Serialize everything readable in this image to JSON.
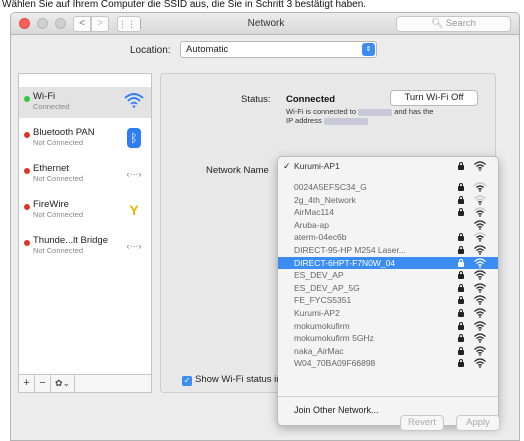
{
  "caption": "Wählen Sie auf Ihrem Computer die SSID aus, die Sie in Schritt 3 bestätigt haben.",
  "window": {
    "title": "Network",
    "search_placeholder": "Search",
    "back_label": "<",
    "forward_label": ">",
    "grid_label": "⋮⋮⋮"
  },
  "location": {
    "label": "Location:",
    "value": "Automatic",
    "arrows": "⇕"
  },
  "services": [
    {
      "name": "Wi-Fi",
      "status": "Connected",
      "status_color": "#2ecb41",
      "icon": "wifi-icon",
      "selected": true
    },
    {
      "name": "Bluetooth PAN",
      "status": "Not Connected",
      "status_color": "#e0332c",
      "icon": "bluetooth-icon",
      "glyph": "ᛒ"
    },
    {
      "name": "Ethernet",
      "status": "Not Connected",
      "status_color": "#e0332c",
      "icon": "ethernet-icon",
      "glyph": "‹···›"
    },
    {
      "name": "FireWire",
      "status": "Not Connected",
      "status_color": "#e0332c",
      "icon": "firewire-icon",
      "glyph": "Y"
    },
    {
      "name": "Thunde...lt Bridge",
      "status": "Not Connected",
      "status_color": "#e0332c",
      "icon": "thunderbolt-bridge-icon",
      "glyph": "‹···›"
    }
  ],
  "sidebar_controls": {
    "add": "+",
    "remove": "−",
    "action": "✿⌄"
  },
  "status": {
    "label": "Status:",
    "value": "Connected",
    "desc_line1_prefix": "Wi-Fi is connected to",
    "desc_line1_suffix": "and has the",
    "desc_line2_prefix": "IP address",
    "turn_off_label": "Turn Wi-Fi Off"
  },
  "network_name_label": "Network Name",
  "network_menu": {
    "check": "✓",
    "items": [
      {
        "name": "Kurumi-AP1",
        "signal": 3,
        "lock": true
      },
      {
        "name": "0024A5EFSC34_G",
        "signal": 2,
        "lock": true
      },
      {
        "name": "2g_4th_Network",
        "signal": 1,
        "lock": true
      },
      {
        "name": "AirMac114",
        "signal": 2,
        "lock": true
      },
      {
        "name": "Aruba-ap",
        "signal": 3,
        "lock": false
      },
      {
        "name": "aterm-04ec6b",
        "signal": 2,
        "lock": true
      },
      {
        "name": "DIRECT-95-HP M254 Laser...",
        "signal": 3,
        "lock": true
      },
      {
        "name": "DIRECT-6HPT-F7N0W_04",
        "signal": 3,
        "lock": true,
        "highlighted": true
      },
      {
        "name": "ES_DEV_AP",
        "signal": 3,
        "lock": true
      },
      {
        "name": "ES_DEV_AP_5G",
        "signal": 3,
        "lock": true
      },
      {
        "name": "FE_FYCS5351",
        "signal": 3,
        "lock": true
      },
      {
        "name": "Kurumi-AP2",
        "signal": 3,
        "lock": true
      },
      {
        "name": "mokumokufirm",
        "signal": 3,
        "lock": true
      },
      {
        "name": "mokumokufirm 5GHz",
        "signal": 3,
        "lock": true
      },
      {
        "name": "naka_AirMac",
        "signal": 3,
        "lock": true
      },
      {
        "name": "W04_70BA09F66898",
        "signal": 3,
        "lock": true
      }
    ],
    "join_label": "Join Other Network..."
  },
  "show_wifi_label": "Show Wi-Fi status in menu bar",
  "buttons": {
    "revert": "Revert",
    "apply": "Apply"
  }
}
